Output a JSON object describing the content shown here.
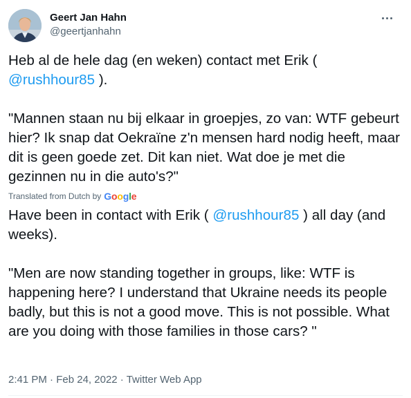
{
  "author": {
    "display_name": "Geert Jan Hahn",
    "handle": "@geertjanhahn",
    "avatar_icon": "profile-photo-icon"
  },
  "more_icon": "more-horizontal-icon",
  "tweet": {
    "para1_before": "Heb al de hele dag (en weken) contact met Erik ( ",
    "para1_mention": "@rushhour85",
    "para1_after": " ).",
    "para2": "\"Mannen staan nu bij elkaar in groepjes, zo van: WTF gebeurt hier? Ik snap dat Oekraïne z'n mensen hard nodig heeft, maar dit is geen goede zet. Dit kan niet. Wat doe je met die gezinnen nu in die auto's?\""
  },
  "translation_notice": {
    "label": "Translated from Dutch by",
    "google": [
      "G",
      "o",
      "o",
      "g",
      "l",
      "e"
    ]
  },
  "translation": {
    "para1_before": "Have been in contact with Erik ( ",
    "para1_mention": "@rushhour85",
    "para1_after": " ) all day (and weeks).",
    "para2": " \"Men are now standing together in groups, like: WTF is happening here? I understand that Ukraine needs its people badly, but this is not a good move. This is not possible. What are you doing with those families in those cars? \""
  },
  "meta": {
    "time": "2:41 PM",
    "date": "Feb 24, 2022",
    "separator": "·",
    "source": "Twitter Web App"
  },
  "colors": {
    "link": "#1d9bf0",
    "secondary_text": "#536471",
    "primary_text": "#0f1419"
  }
}
